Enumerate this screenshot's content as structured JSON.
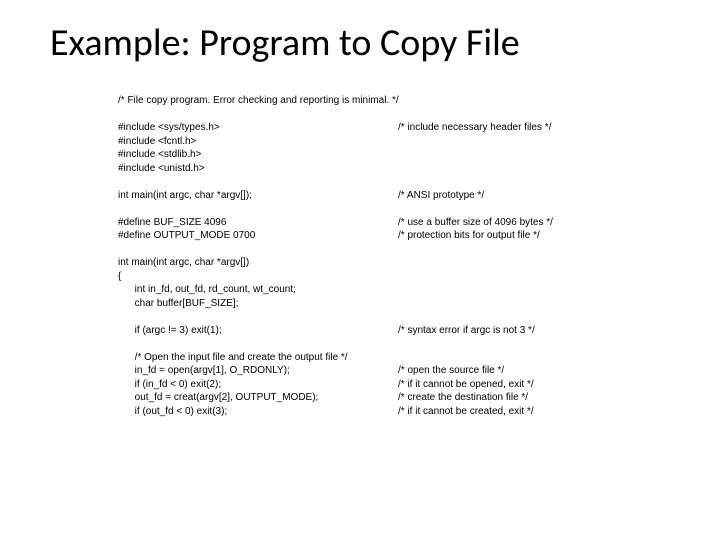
{
  "title": "Example: Program to Copy File",
  "code": [
    {
      "left": "/* File copy program. Error checking and reporting is minimal. */",
      "right": ""
    },
    {
      "blank": true
    },
    {
      "left": "#include <sys/types.h>",
      "right": "/* include necessary header files */"
    },
    {
      "left": "#include <fcntl.h>",
      "right": ""
    },
    {
      "left": "#include <stdlib.h>",
      "right": ""
    },
    {
      "left": "#include <unistd.h>",
      "right": ""
    },
    {
      "blank": true
    },
    {
      "left": "int main(int argc, char *argv[]);",
      "right": "/* ANSI prototype */"
    },
    {
      "blank": true
    },
    {
      "left": "#define BUF_SIZE 4096",
      "right": "/* use a buffer size of 4096 bytes */"
    },
    {
      "left": "#define OUTPUT_MODE 0700",
      "right": "/* protection bits for output file */"
    },
    {
      "blank": true
    },
    {
      "left": "int main(int argc, char *argv[])",
      "right": ""
    },
    {
      "left": "{",
      "right": ""
    },
    {
      "left": "      int in_fd, out_fd, rd_count, wt_count;",
      "right": ""
    },
    {
      "left": "      char buffer[BUF_SIZE];",
      "right": ""
    },
    {
      "blank": true
    },
    {
      "left": "      if (argc != 3) exit(1);",
      "right": "/* syntax error if argc is not 3 */"
    },
    {
      "blank": true
    },
    {
      "left": "      /* Open the input file and create the output file */",
      "right": ""
    },
    {
      "left": "      in_fd = open(argv[1], O_RDONLY);",
      "right": "/* open the source file */"
    },
    {
      "left": "      if (in_fd < 0) exit(2);",
      "right": "/* if it cannot be opened, exit */"
    },
    {
      "left": "      out_fd = creat(argv[2], OUTPUT_MODE);",
      "right": "/* create the destination file */"
    },
    {
      "left": "      if (out_fd < 0) exit(3);",
      "right": "/* if it cannot be created, exit */"
    }
  ]
}
